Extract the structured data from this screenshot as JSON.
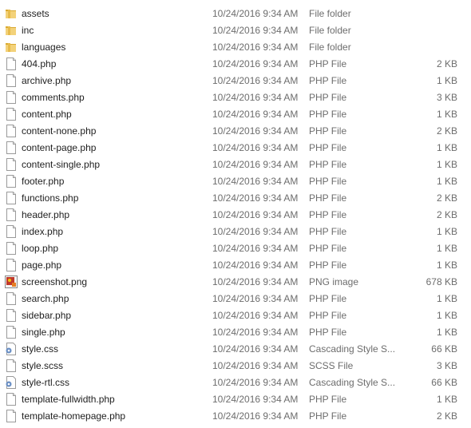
{
  "files": [
    {
      "name": "assets",
      "date": "10/24/2016 9:34 AM",
      "type": "File folder",
      "size": "",
      "icon": "folder-icon"
    },
    {
      "name": "inc",
      "date": "10/24/2016 9:34 AM",
      "type": "File folder",
      "size": "",
      "icon": "folder-icon"
    },
    {
      "name": "languages",
      "date": "10/24/2016 9:34 AM",
      "type": "File folder",
      "size": "",
      "icon": "folder-icon"
    },
    {
      "name": "404.php",
      "date": "10/24/2016 9:34 AM",
      "type": "PHP File",
      "size": "2 KB",
      "icon": "file-icon"
    },
    {
      "name": "archive.php",
      "date": "10/24/2016 9:34 AM",
      "type": "PHP File",
      "size": "1 KB",
      "icon": "file-icon"
    },
    {
      "name": "comments.php",
      "date": "10/24/2016 9:34 AM",
      "type": "PHP File",
      "size": "3 KB",
      "icon": "file-icon"
    },
    {
      "name": "content.php",
      "date": "10/24/2016 9:34 AM",
      "type": "PHP File",
      "size": "1 KB",
      "icon": "file-icon"
    },
    {
      "name": "content-none.php",
      "date": "10/24/2016 9:34 AM",
      "type": "PHP File",
      "size": "2 KB",
      "icon": "file-icon"
    },
    {
      "name": "content-page.php",
      "date": "10/24/2016 9:34 AM",
      "type": "PHP File",
      "size": "1 KB",
      "icon": "file-icon"
    },
    {
      "name": "content-single.php",
      "date": "10/24/2016 9:34 AM",
      "type": "PHP File",
      "size": "1 KB",
      "icon": "file-icon"
    },
    {
      "name": "footer.php",
      "date": "10/24/2016 9:34 AM",
      "type": "PHP File",
      "size": "1 KB",
      "icon": "file-icon"
    },
    {
      "name": "functions.php",
      "date": "10/24/2016 9:34 AM",
      "type": "PHP File",
      "size": "2 KB",
      "icon": "file-icon"
    },
    {
      "name": "header.php",
      "date": "10/24/2016 9:34 AM",
      "type": "PHP File",
      "size": "2 KB",
      "icon": "file-icon"
    },
    {
      "name": "index.php",
      "date": "10/24/2016 9:34 AM",
      "type": "PHP File",
      "size": "1 KB",
      "icon": "file-icon"
    },
    {
      "name": "loop.php",
      "date": "10/24/2016 9:34 AM",
      "type": "PHP File",
      "size": "1 KB",
      "icon": "file-icon"
    },
    {
      "name": "page.php",
      "date": "10/24/2016 9:34 AM",
      "type": "PHP File",
      "size": "1 KB",
      "icon": "file-icon"
    },
    {
      "name": "screenshot.png",
      "date": "10/24/2016 9:34 AM",
      "type": "PNG image",
      "size": "678 KB",
      "icon": "image-icon"
    },
    {
      "name": "search.php",
      "date": "10/24/2016 9:34 AM",
      "type": "PHP File",
      "size": "1 KB",
      "icon": "file-icon"
    },
    {
      "name": "sidebar.php",
      "date": "10/24/2016 9:34 AM",
      "type": "PHP File",
      "size": "1 KB",
      "icon": "file-icon"
    },
    {
      "name": "single.php",
      "date": "10/24/2016 9:34 AM",
      "type": "PHP File",
      "size": "1 KB",
      "icon": "file-icon"
    },
    {
      "name": "style.css",
      "date": "10/24/2016 9:34 AM",
      "type": "Cascading Style S...",
      "size": "66 KB",
      "icon": "css-file-icon"
    },
    {
      "name": "style.scss",
      "date": "10/24/2016 9:34 AM",
      "type": "SCSS File",
      "size": "3 KB",
      "icon": "file-icon"
    },
    {
      "name": "style-rtl.css",
      "date": "10/24/2016 9:34 AM",
      "type": "Cascading Style S...",
      "size": "66 KB",
      "icon": "css-file-icon"
    },
    {
      "name": "template-fullwidth.php",
      "date": "10/24/2016 9:34 AM",
      "type": "PHP File",
      "size": "1 KB",
      "icon": "file-icon"
    },
    {
      "name": "template-homepage.php",
      "date": "10/24/2016 9:34 AM",
      "type": "PHP File",
      "size": "2 KB",
      "icon": "file-icon"
    }
  ],
  "colors": {
    "name_text": "#1e1e1e",
    "detail_text": "#6d6d6d",
    "folder": "#e8c465"
  }
}
